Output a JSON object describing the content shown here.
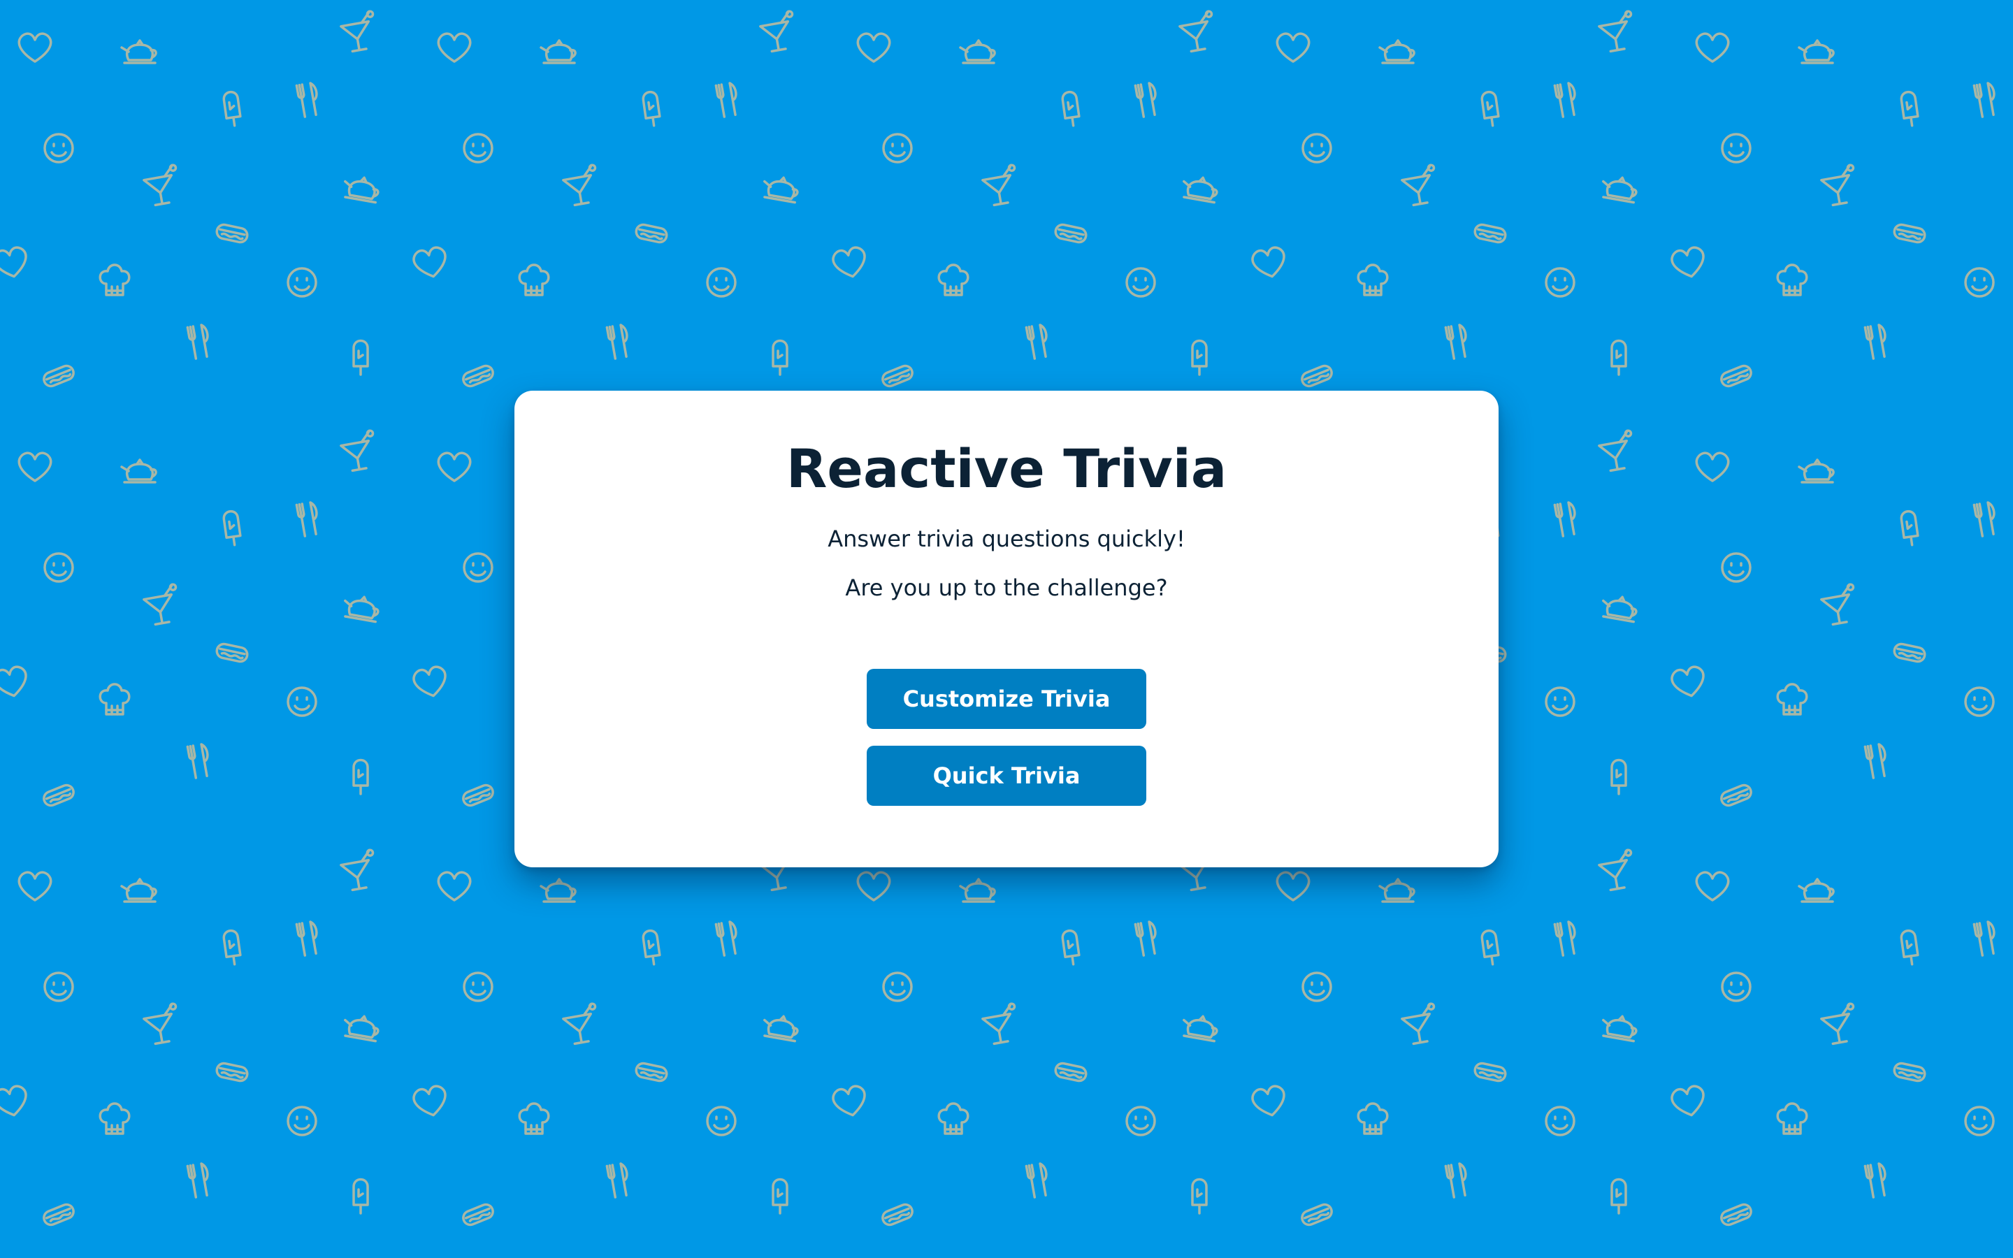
{
  "colors": {
    "background": "#0098e6",
    "pattern_icon": "#a8b7a6",
    "card": "#ffffff",
    "title_text": "#0c2235",
    "button": "#007fc2",
    "button_text": "#ffffff"
  },
  "background_pattern": {
    "icons": [
      "heart-icon",
      "teapot-icon",
      "cocktail-icon",
      "popsicle-icon",
      "fork-knife-icon",
      "smiley-icon",
      "hotdog-icon",
      "chef-hat-icon"
    ]
  },
  "card": {
    "title": "Reactive Trivia",
    "line1": "Answer trivia questions quickly!",
    "line2": "Are you up to the challenge?",
    "buttons": {
      "customize": "Customize Trivia",
      "quick": "Quick Trivia"
    }
  }
}
